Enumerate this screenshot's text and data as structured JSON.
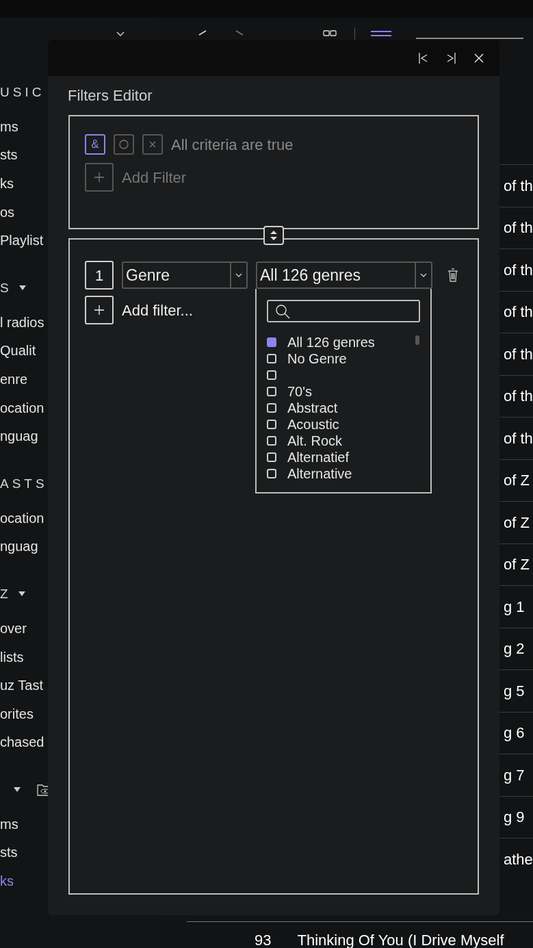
{
  "sidebar": {
    "sections": [
      {
        "header": "USIC",
        "items": [
          {
            "label": "ms",
            "selected": false
          },
          {
            "label": "sts",
            "selected": false
          },
          {
            "label": "ks",
            "selected": false
          },
          {
            "label": "os",
            "selected": false
          },
          {
            "label": "Playlist",
            "selected": false
          }
        ]
      },
      {
        "header": "S",
        "caret": true,
        "items": [
          {
            "label": "l radios",
            "selected": false
          },
          {
            "label": "Qualit",
            "selected": false
          },
          {
            "label": "enre",
            "selected": false
          },
          {
            "label": "ocation",
            "selected": false
          },
          {
            "label": "nguag",
            "selected": false
          }
        ]
      },
      {
        "header": "ASTS",
        "items": [
          {
            "label": "ocation",
            "selected": false
          },
          {
            "label": "nguag",
            "selected": false
          }
        ]
      },
      {
        "header": "Z",
        "caret": true,
        "items": [
          {
            "label": "over",
            "selected": false
          },
          {
            "label": "lists",
            "selected": false
          },
          {
            "label": "uz Tast",
            "selected": false
          },
          {
            "label": "orites",
            "selected": false
          },
          {
            "label": "chased",
            "selected": false
          }
        ]
      },
      {
        "caret": true,
        "folder_icon": true,
        "items": [
          {
            "label": "ms",
            "selected": false
          },
          {
            "label": "sts",
            "selected": false
          },
          {
            "label": "ks",
            "selected": true
          }
        ]
      }
    ]
  },
  "track_rows": [
    "of th",
    "of th",
    "of th",
    "of th",
    "of th",
    "of th",
    "of th",
    "of Z",
    "of Z",
    "of Z",
    "g 1",
    "g 2",
    "g 5",
    "g 6",
    "g 7",
    "g 9",
    "athe"
  ],
  "bottom_row": {
    "number": "93",
    "title": "Thinking Of You (I Drive Myself"
  },
  "dialog": {
    "title": "Filters Editor",
    "modes": [
      {
        "kind": "and",
        "label": "&",
        "selected": true
      },
      {
        "kind": "or",
        "selected": false
      },
      {
        "kind": "not",
        "selected": false
      }
    ],
    "criteria_text": "All criteria are true",
    "top_add": {
      "label": "Add Filter",
      "disabled": true
    },
    "filters": [
      {
        "index": "1",
        "field": "Genre",
        "value": "All 126 genres",
        "open": true,
        "options": [
          {
            "label": "All 126 genres",
            "checked": true
          },
          {
            "label": "No Genre",
            "checked": false
          },
          {
            "checked": false
          },
          {
            "label": "70's",
            "checked": false
          },
          {
            "label": "Abstract",
            "checked": false
          },
          {
            "label": "Acoustic",
            "checked": false
          },
          {
            "label": "Alt. Rock",
            "checked": false
          },
          {
            "label": "Alternatief",
            "checked": false
          },
          {
            "label": "Alternative",
            "checked": false
          }
        ]
      }
    ],
    "add_filter": {
      "label": "Add filter...",
      "disabled": false
    }
  }
}
